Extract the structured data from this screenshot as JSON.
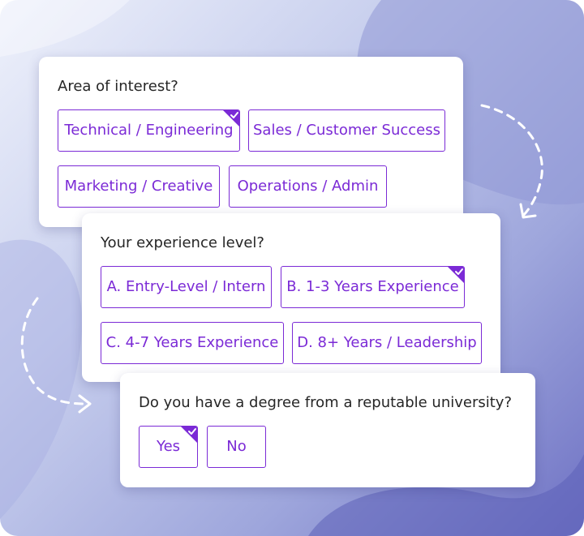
{
  "questions": [
    {
      "title": "Area of interest?",
      "options": [
        {
          "label": "Technical / Engineering",
          "selected": true
        },
        {
          "label": "Sales / Customer Success",
          "selected": false
        },
        {
          "label": "Marketing / Creative",
          "selected": false
        },
        {
          "label": "Operations / Admin",
          "selected": false
        }
      ]
    },
    {
      "title": "Your experience level?",
      "options": [
        {
          "label": "A. Entry-Level / Intern",
          "selected": false
        },
        {
          "label": "B. 1-3 Years Experience",
          "selected": true
        },
        {
          "label": "C. 4-7 Years Experience",
          "selected": false
        },
        {
          "label": "D. 8+ Years / Leadership",
          "selected": false
        }
      ]
    },
    {
      "title": "Do you have a degree from a reputable university?",
      "options": [
        {
          "label": "Yes",
          "selected": true
        },
        {
          "label": "No",
          "selected": false
        }
      ]
    }
  ],
  "colors": {
    "accent": "#7b2ad6",
    "card_bg": "#ffffff",
    "question_text": "#262626",
    "arrow": "#ffffff"
  },
  "icons": [
    "checkmark-icon",
    "dashed-arrow-icon"
  ]
}
